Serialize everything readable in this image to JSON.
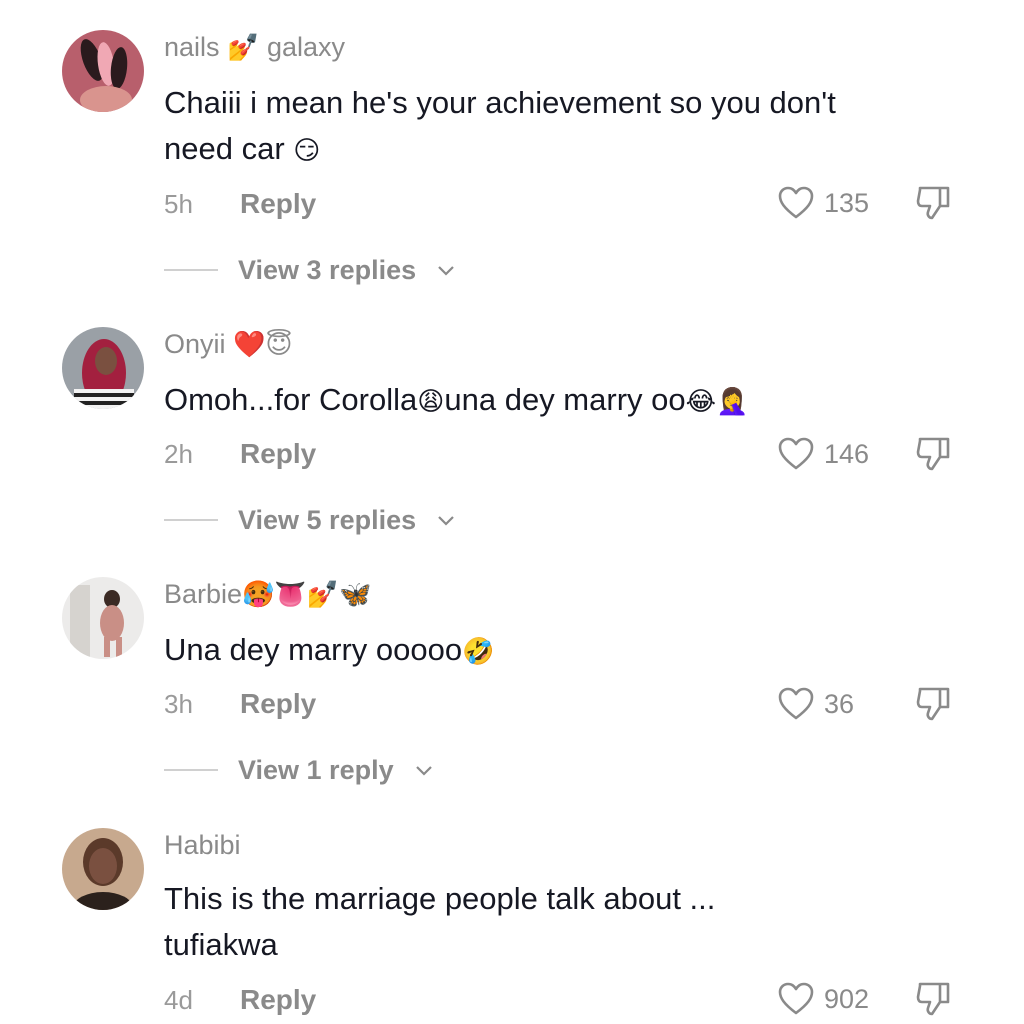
{
  "comments": [
    {
      "username": "nails",
      "username_suffix": "galaxy",
      "username_emoji": "💅",
      "text_line1": "Chaiii i mean he's your achievement so you don't",
      "text_line2": "need car",
      "text_emoji": "😏",
      "time": "5h",
      "reply_label": "Reply",
      "likes": "135",
      "view_replies": "View 3 replies",
      "avatar_color": "#c8737e"
    },
    {
      "username": "Onyii",
      "username_emoji": "❤️😇",
      "text_parts": [
        "Omoh...for Corolla",
        "😩",
        "una dey marry oo",
        "😂🤦‍♀️"
      ],
      "time": "2h",
      "reply_label": "Reply",
      "likes": "146",
      "view_replies": "View 5 replies",
      "avatar_color": "#b3325a"
    },
    {
      "username": "Barbie",
      "username_emoji": "🥵👅💅🦋",
      "text": "Una dey marry ooooo",
      "text_emoji": "🤣",
      "time": "3h",
      "reply_label": "Reply",
      "likes": "36",
      "view_replies": "View 1 reply",
      "avatar_color": "#e9e6e4"
    },
    {
      "username": "Habibi",
      "text_line1": "This is the marriage people talk about ...",
      "text_line2": "tufiakwa",
      "time": "4d",
      "reply_label": "Reply",
      "likes": "902",
      "avatar_color": "#6b4a3a"
    }
  ],
  "icons": {
    "like": "heart-outline-icon",
    "dislike": "thumbs-down-icon",
    "expand": "chevron-down-icon"
  },
  "colors": {
    "text": "#161823",
    "muted": "#8a8a8a"
  }
}
